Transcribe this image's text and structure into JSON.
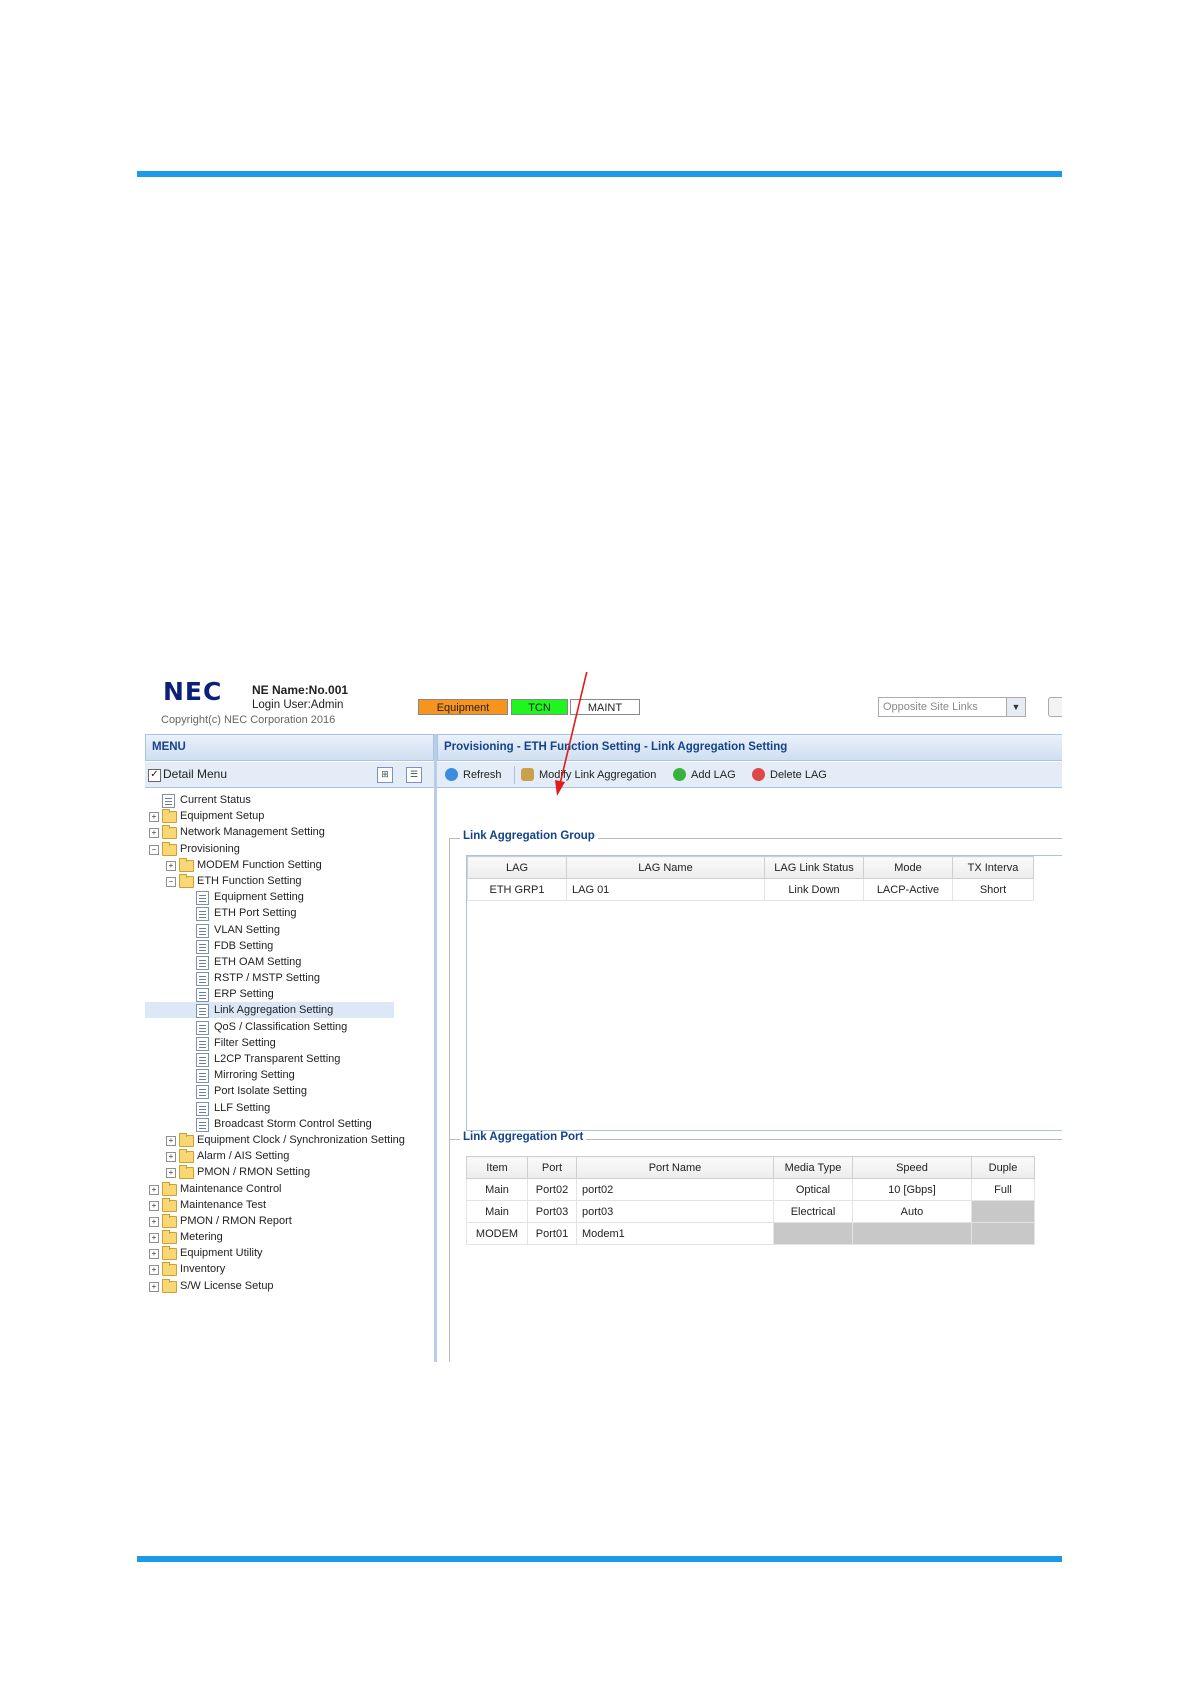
{
  "header": {
    "logo": "NEC",
    "ne_name": "NE Name:No.001",
    "login_user": "Login User:Admin",
    "copyright": "Copyright(c) NEC Corporation 2016",
    "buttons": {
      "equipment": "Equipment",
      "tcn": "TCN",
      "maint": "MAINT"
    },
    "colors": {
      "equipment": "#f6941d",
      "tcn": "#1ff51f",
      "maint": "#ffffff"
    },
    "opposite_site_links": "Opposite Site Links"
  },
  "menu": {
    "title": "MENU",
    "detail_menu_label": "Detail Menu",
    "detail_menu_checked": true,
    "items": [
      {
        "label": "Current Status",
        "type": "page",
        "level": 0
      },
      {
        "label": "Equipment Setup",
        "type": "folder",
        "level": 0,
        "expanded": false
      },
      {
        "label": "Network Management Setting",
        "type": "folder",
        "level": 0,
        "expanded": false
      },
      {
        "label": "Provisioning",
        "type": "folder",
        "level": 0,
        "expanded": true
      },
      {
        "label": "MODEM Function Setting",
        "type": "folder",
        "level": 1,
        "expanded": false
      },
      {
        "label": "ETH Function Setting",
        "type": "folder",
        "level": 1,
        "expanded": true
      },
      {
        "label": "Equipment Setting",
        "type": "page",
        "level": 2
      },
      {
        "label": "ETH Port Setting",
        "type": "page",
        "level": 2
      },
      {
        "label": "VLAN Setting",
        "type": "page",
        "level": 2
      },
      {
        "label": "FDB Setting",
        "type": "page",
        "level": 2
      },
      {
        "label": "ETH OAM Setting",
        "type": "page",
        "level": 2
      },
      {
        "label": "RSTP / MSTP Setting",
        "type": "page",
        "level": 2
      },
      {
        "label": "ERP Setting",
        "type": "page",
        "level": 2
      },
      {
        "label": "Link Aggregation Setting",
        "type": "page",
        "level": 2,
        "selected": true
      },
      {
        "label": "QoS / Classification Setting",
        "type": "page",
        "level": 2
      },
      {
        "label": "Filter Setting",
        "type": "page",
        "level": 2
      },
      {
        "label": "L2CP Transparent Setting",
        "type": "page",
        "level": 2
      },
      {
        "label": "Mirroring Setting",
        "type": "page",
        "level": 2
      },
      {
        "label": "Port Isolate Setting",
        "type": "page",
        "level": 2
      },
      {
        "label": "LLF Setting",
        "type": "page",
        "level": 2
      },
      {
        "label": "Broadcast Storm Control Setting",
        "type": "page",
        "level": 2
      },
      {
        "label": "Equipment Clock / Synchronization Setting",
        "type": "folder",
        "level": 1,
        "expanded": false
      },
      {
        "label": "Alarm / AIS Setting",
        "type": "folder",
        "level": 1,
        "expanded": false
      },
      {
        "label": "PMON / RMON Setting",
        "type": "folder",
        "level": 1,
        "expanded": false
      },
      {
        "label": "Maintenance Control",
        "type": "folder",
        "level": 0,
        "expanded": false
      },
      {
        "label": "Maintenance Test",
        "type": "folder",
        "level": 0,
        "expanded": false
      },
      {
        "label": "PMON / RMON Report",
        "type": "folder",
        "level": 0,
        "expanded": false
      },
      {
        "label": "Metering",
        "type": "folder",
        "level": 0,
        "expanded": false
      },
      {
        "label": "Equipment Utility",
        "type": "folder",
        "level": 0,
        "expanded": false
      },
      {
        "label": "Inventory",
        "type": "folder",
        "level": 0,
        "expanded": false
      },
      {
        "label": "S/W License Setup",
        "type": "folder",
        "level": 0,
        "expanded": false
      }
    ]
  },
  "content": {
    "breadcrumb": "Provisioning - ETH Function Setting - Link Aggregation Setting",
    "toolbar": {
      "refresh": "Refresh",
      "modify": "Modify Link Aggregation",
      "add": "Add LAG",
      "delete": "Delete LAG"
    },
    "lag_group": {
      "title": "Link Aggregation Group",
      "columns": [
        "LAG",
        "LAG Name",
        "LAG Link Status",
        "Mode",
        "TX Interva"
      ],
      "rows": [
        [
          "ETH GRP1",
          "LAG 01",
          "Link Down",
          "LACP-Active",
          "Short"
        ]
      ]
    },
    "lag_port": {
      "title": "Link Aggregation Port",
      "columns": [
        "Item",
        "Port",
        "Port Name",
        "Media Type",
        "Speed",
        "Duple"
      ],
      "rows": [
        [
          "Main",
          "Port02",
          "port02",
          "Optical",
          "10 [Gbps]",
          "Full"
        ],
        [
          "Main",
          "Port03",
          "port03",
          "Electrical",
          "Auto",
          ""
        ],
        [
          "MODEM",
          "Port01",
          "Modem1",
          "",
          "",
          ""
        ]
      ]
    }
  },
  "annotation": {
    "arrow_color": "#e31b1b"
  }
}
